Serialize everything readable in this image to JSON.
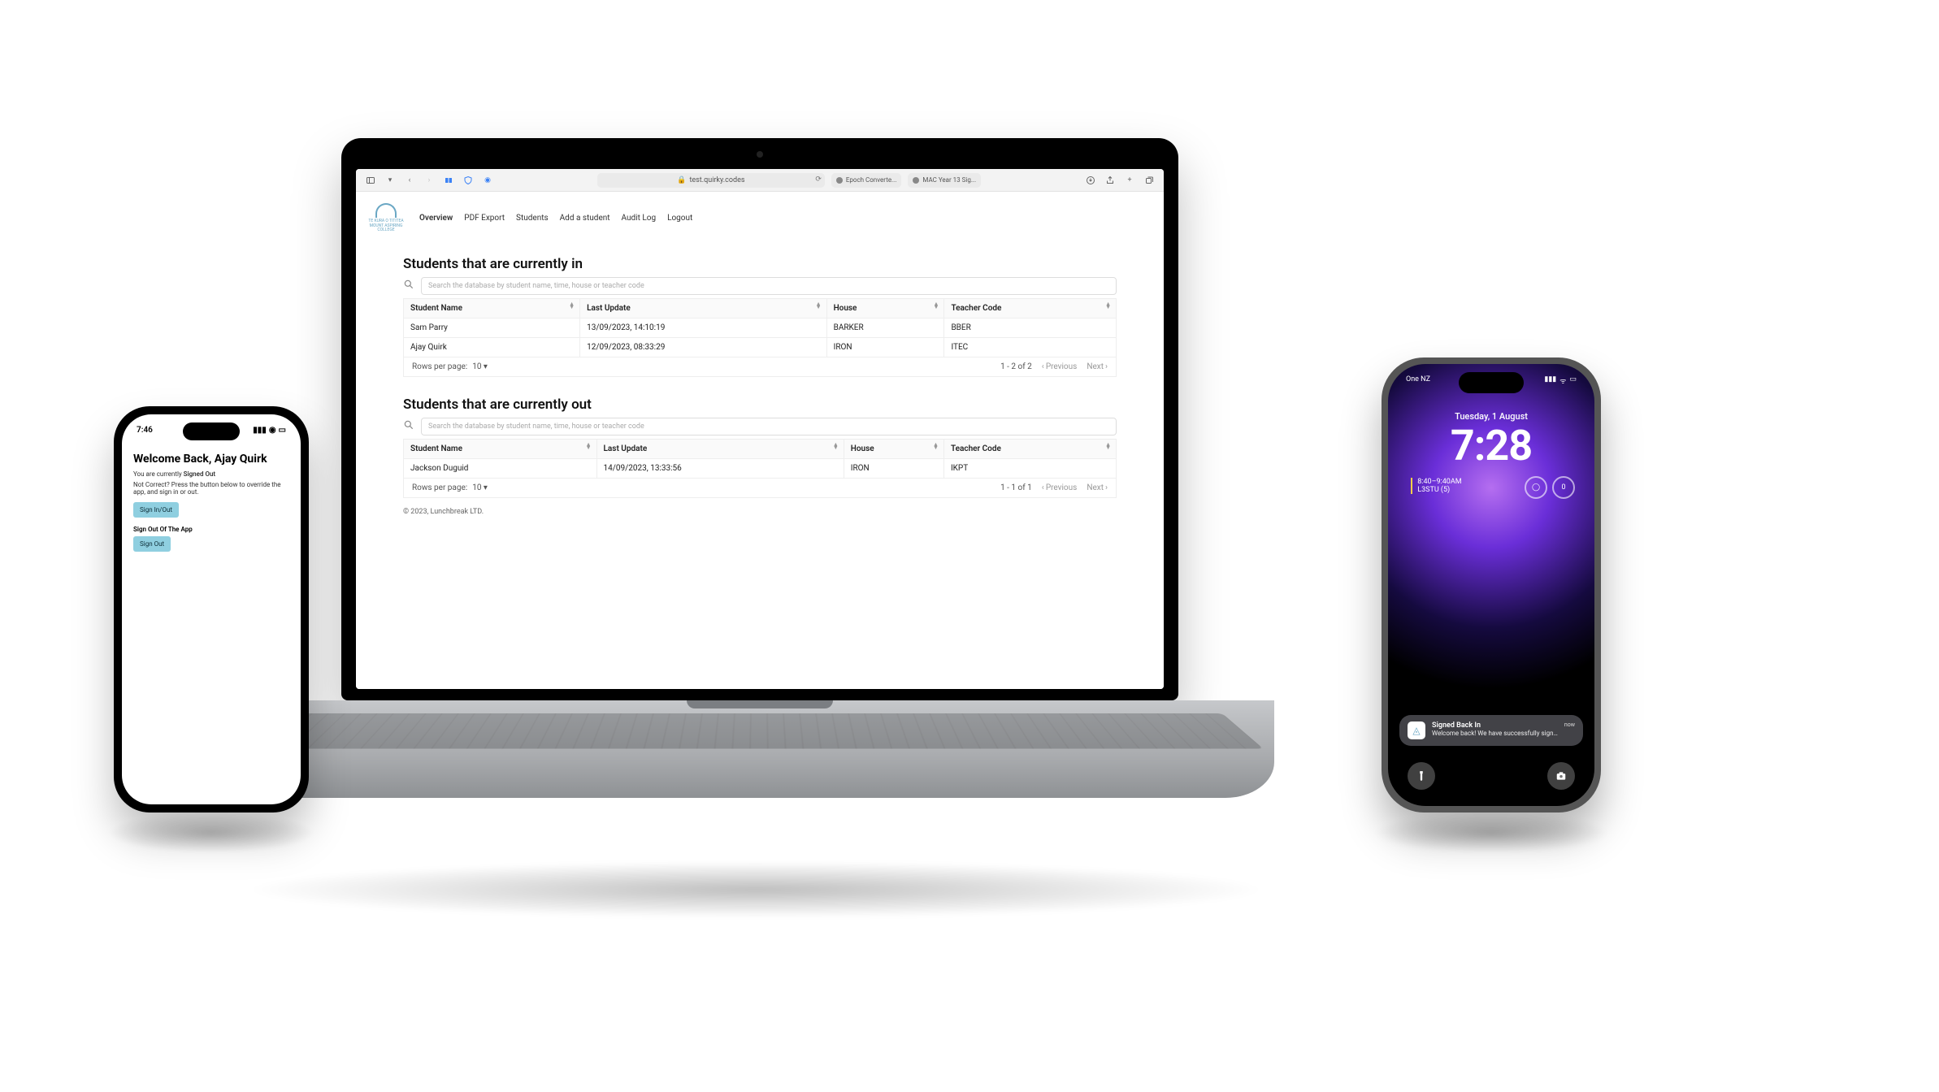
{
  "safari": {
    "url": "test.quirky.codes",
    "tabs": [
      {
        "label": "Epoch Converte..."
      },
      {
        "label": "MAC Year 13 Sig..."
      }
    ]
  },
  "app": {
    "logo_line1": "TE KURA O TITITEA",
    "logo_line2": "MOUNT ASPIRING COLLEGE",
    "nav": {
      "overview": "Overview",
      "pdf": "PDF Export",
      "students": "Students",
      "add": "Add a student",
      "audit": "Audit Log",
      "logout": "Logout"
    },
    "search_placeholder": "Search the database by student name, time, house or teacher code",
    "columns": {
      "name": "Student Name",
      "last": "Last Update",
      "house": "House",
      "teacher": "Teacher Code"
    },
    "sections": {
      "in": {
        "title": "Students that are currently in",
        "rows": [
          {
            "name": "Sam Parry",
            "last": "13/09/2023, 14:10:19",
            "house": "BARKER",
            "teacher": "BBER"
          },
          {
            "name": "Ajay Quirk",
            "last": "12/09/2023, 08:33:29",
            "house": "IRON",
            "teacher": "ITEC"
          }
        ],
        "rows_label": "Rows per page:",
        "page_size": "10",
        "range": "1 - 2 of 2",
        "prev": "Previous",
        "next": "Next"
      },
      "out": {
        "title": "Students that are currently out",
        "rows": [
          {
            "name": "Jackson Duguid",
            "last": "14/09/2023, 13:33:56",
            "house": "IRON",
            "teacher": "IKPT"
          }
        ],
        "rows_label": "Rows per page:",
        "page_size": "10",
        "range": "1 - 1 of 1",
        "prev": "Previous",
        "next": "Next"
      }
    },
    "footer": "© 2023, Lunchbreak LTD."
  },
  "phone_left": {
    "time": "7:46",
    "title": "Welcome Back, Ajay Quirk",
    "status_prefix": "You are currently ",
    "status_value": "Signed Out",
    "helper": "Not Correct? Press the button below to override the app, and sign in or out.",
    "btn1": "Sign In/Out",
    "sub": "Sign Out Of The App",
    "btn2": "Sign Out"
  },
  "phone_right": {
    "carrier": "One NZ",
    "date": "Tuesday, 1 August",
    "time": "7:28",
    "cal_time": "8:40–9:40AM",
    "cal_title": "L3STU (5)",
    "circle_right": "0",
    "notif_time": "now",
    "notif_title": "Signed Back In",
    "notif_body": "Welcome back! We have successfully signed y..."
  }
}
